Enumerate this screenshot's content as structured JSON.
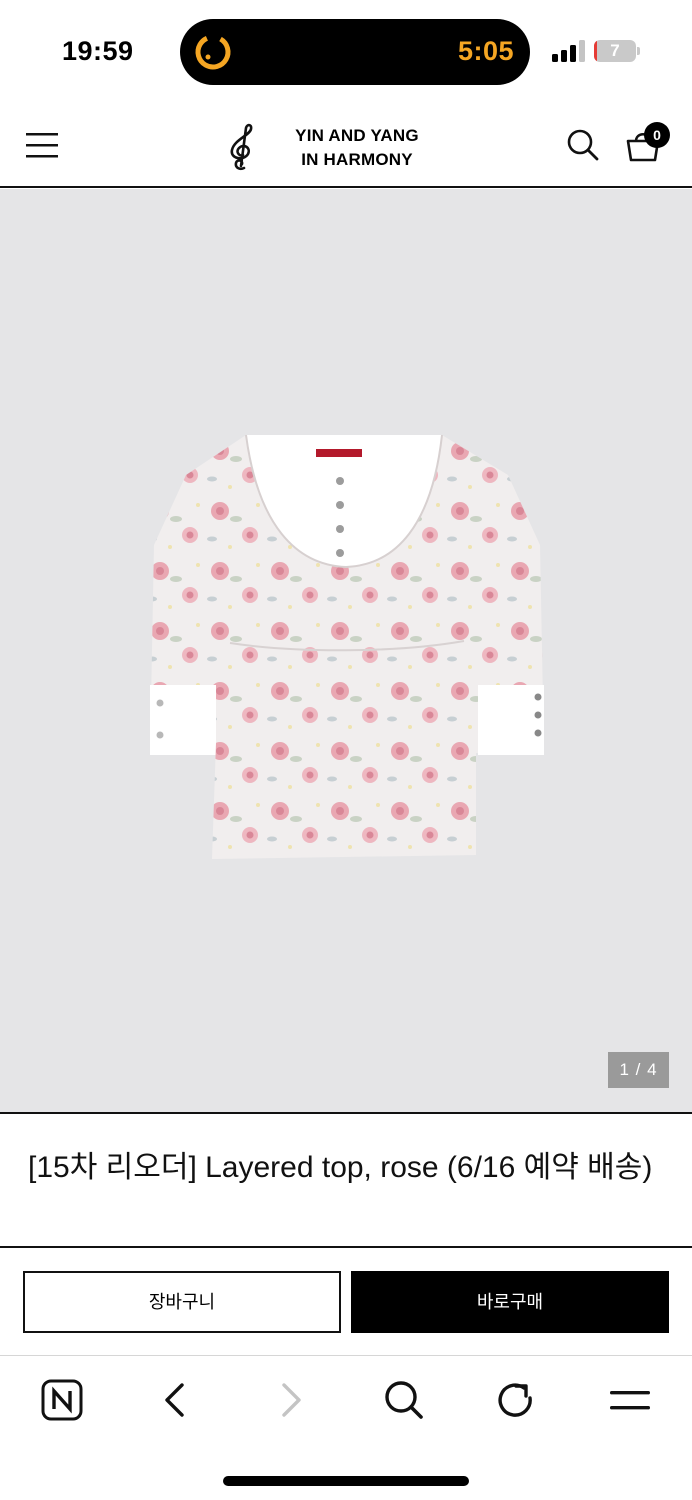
{
  "status_bar": {
    "time": "19:59",
    "island_timer": "5:05",
    "battery_level": "7",
    "battery_fraction": 0.07,
    "colors": {
      "timer": "#f5a623",
      "battery_low": "#e53b35"
    }
  },
  "header": {
    "logo_line1": "YIN AND YANG",
    "logo_line2": "IN HARMONY",
    "cart_count": "0",
    "icons": [
      "menu-icon",
      "treble-clef-icon",
      "search-icon",
      "shopping-bag-icon"
    ]
  },
  "gallery": {
    "page_indicator": "1 / 4",
    "background": "#e5e5e7"
  },
  "product": {
    "title": "[15차 리오더] Layered top, rose (6/16 예약 배송)"
  },
  "actions": {
    "cart_label": "장바구니",
    "buy_label": "바로구매"
  },
  "browser_toolbar": {
    "icons": [
      "naver-n-icon",
      "back-arrow-icon",
      "forward-arrow-icon",
      "search-icon",
      "refresh-icon",
      "menu-icon"
    ]
  }
}
